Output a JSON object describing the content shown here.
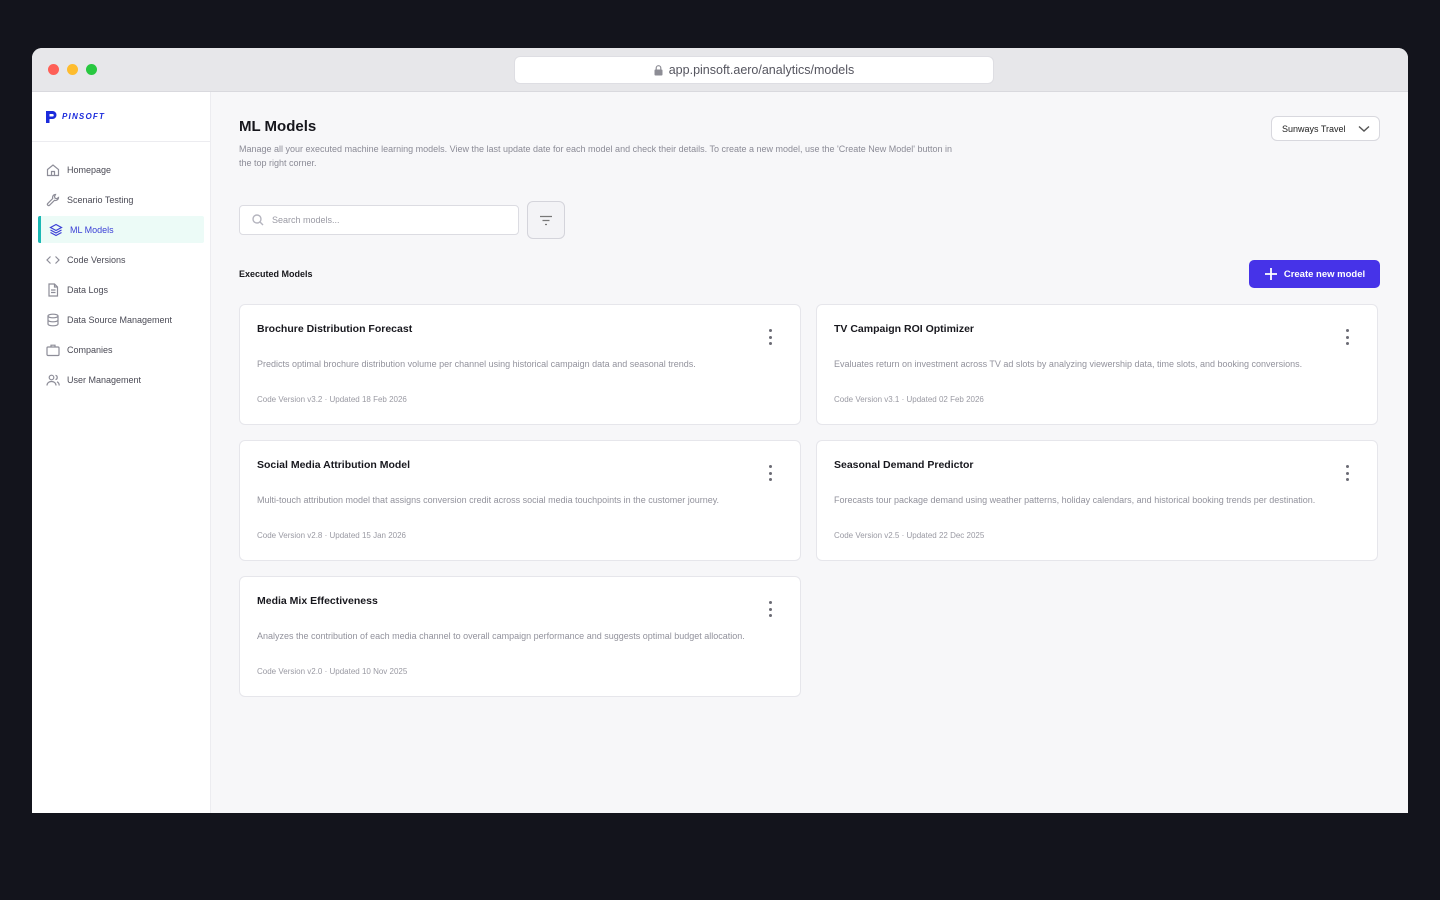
{
  "browser": {
    "url": "app.pinsoft.aero/analytics/models"
  },
  "brand": {
    "name": "PINSOFT"
  },
  "sidebar": {
    "items": [
      {
        "label": "Homepage",
        "icon": "home-icon"
      },
      {
        "label": "Scenario Testing",
        "icon": "wrench-icon"
      },
      {
        "label": "ML Models",
        "icon": "layers-icon",
        "active": true
      },
      {
        "label": "Code Versions",
        "icon": "code-icon"
      },
      {
        "label": "Data Logs",
        "icon": "document-icon"
      },
      {
        "label": "Data Source Management",
        "icon": "database-icon"
      },
      {
        "label": "Companies",
        "icon": "briefcase-icon"
      },
      {
        "label": "User Management",
        "icon": "users-icon"
      }
    ]
  },
  "header": {
    "title": "ML Models",
    "description": "Manage all your executed machine learning models. View the last update date for each model and check their details. To create a new model, use the 'Create New Model' button in the top right corner.",
    "company": "Sunways Travel"
  },
  "search": {
    "placeholder": "Search models..."
  },
  "section": {
    "title": "Executed Models",
    "create_label": "Create new model"
  },
  "models": [
    {
      "title": "Brochure Distribution Forecast",
      "description": "Predicts optimal brochure distribution volume per channel using historical campaign data and seasonal trends.",
      "meta": "Code Version v3.2 · Updated 18 Feb 2026"
    },
    {
      "title": "TV Campaign ROI Optimizer",
      "description": "Evaluates return on investment across TV ad slots by analyzing viewership data, time slots, and booking conversions.",
      "meta": "Code Version v3.1 · Updated 02 Feb 2026"
    },
    {
      "title": "Social Media Attribution Model",
      "description": "Multi-touch attribution model that assigns conversion credit across social media touchpoints in the customer journey.",
      "meta": "Code Version v2.8 · Updated 15 Jan 2026"
    },
    {
      "title": "Seasonal Demand Predictor",
      "description": "Forecasts tour package demand using weather patterns, holiday calendars, and historical booking trends per destination.",
      "meta": "Code Version v2.5 · Updated 22 Dec 2025"
    },
    {
      "title": "Media Mix Effectiveness",
      "description": "Analyzes the contribution of each media channel to overall campaign performance and suggests optimal budget allocation.",
      "meta": "Code Version v2.0 · Updated 10 Nov 2025"
    }
  ],
  "colors": {
    "accent": "#4633e8",
    "active_bar": "#1ab8b4",
    "brand": "#1b2bdc"
  }
}
